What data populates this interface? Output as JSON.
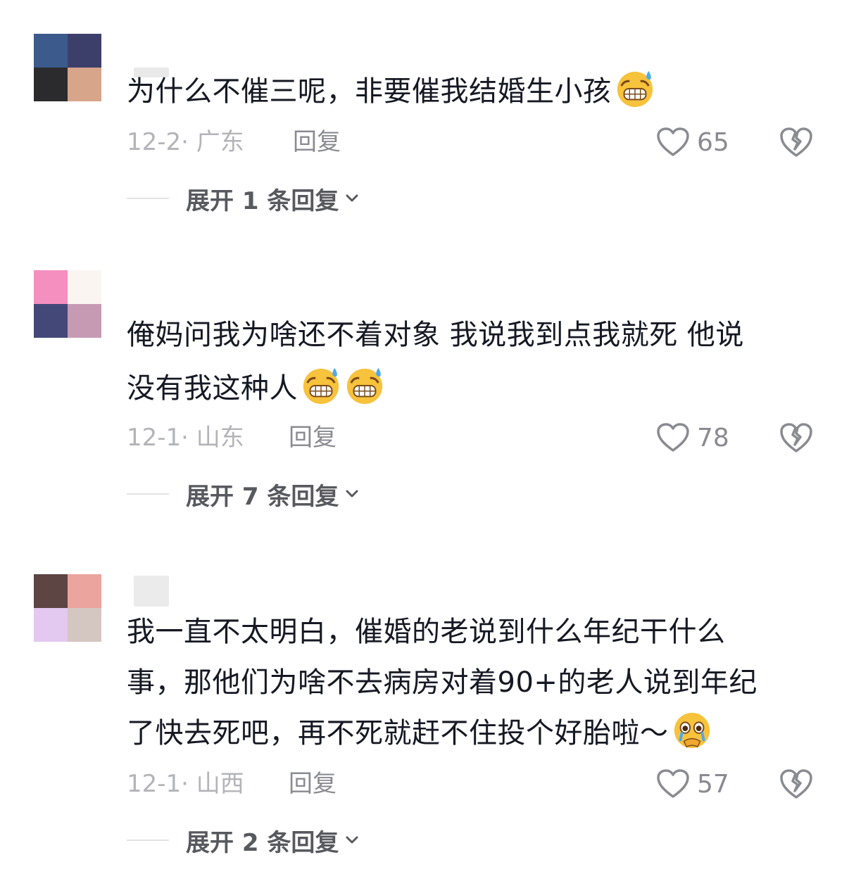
{
  "comments": [
    {
      "text": "为什么不催三呢，非要催我结婚生小孩",
      "emojis": [
        "grimacing-sweat-emoji"
      ],
      "date_location": "12-2· 广东",
      "reply_label": "回复",
      "likes": "65",
      "expand_label": "展开 1 条回复",
      "avatar_colors": [
        "#3c5a8c",
        "#3d3f6b",
        "#2b2b2d",
        "#d6a58a"
      ]
    },
    {
      "text_line1": "俺妈问我为啥还不着对象 我说我到点我就死 他说",
      "text_line2": "没有我这种人",
      "emojis": [
        "grimacing-sweat-emoji",
        "grimacing-sweat-emoji"
      ],
      "date_location": "12-1· 山东",
      "reply_label": "回复",
      "likes": "78",
      "expand_label": "展开 7 条回复",
      "avatar_colors": [
        "#f48fbf",
        "#fbf5f2",
        "#434878",
        "#c79ab4"
      ]
    },
    {
      "text_line1": "我一直不太明白，催婚的老说到什么年纪干什么",
      "text_line2": "事，那他们为啥不去病房对着90+的老人说到年纪",
      "text_line3": "了快去死吧，再不死就赶不住投个好胎啦～",
      "emojis": [
        "pleading-crying-emoji"
      ],
      "date_location": "12-1· 山西",
      "reply_label": "回复",
      "likes": "57",
      "expand_label": "展开 2 条回复",
      "avatar_colors": [
        "#5c4543",
        "#eba49e",
        "#e3c8f0",
        "#d4c6c0"
      ]
    }
  ],
  "colors": {
    "text": "#161823",
    "meta": "#b3b4b8",
    "action": "#8a8b91",
    "expand": "#58595e"
  }
}
